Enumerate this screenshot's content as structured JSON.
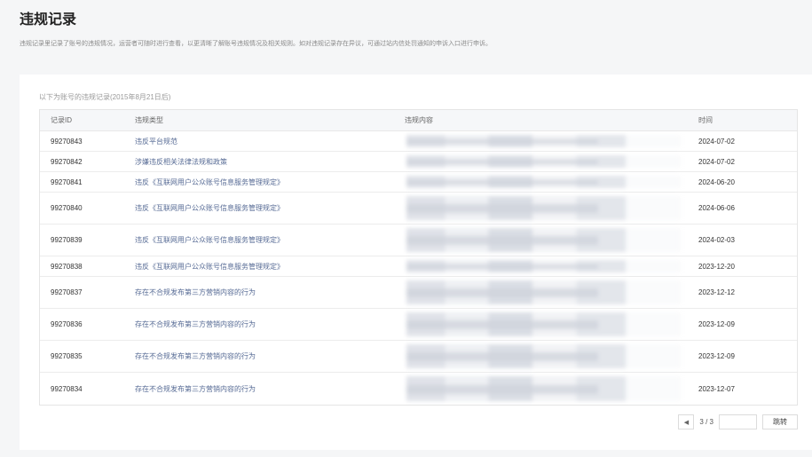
{
  "page": {
    "title": "违规记录",
    "description": "违规记录里记录了账号的违规情况，运营者可随时进行查看，以更清晰了解账号违规情况及相关规则。如对违规记录存在异议，可通过站内信处罚通知的申诉入口进行申诉。"
  },
  "table": {
    "caption": "以下为账号的违规记录(2015年8月21日后)",
    "columns": {
      "id": "记录ID",
      "type": "违规类型",
      "content": "违规内容",
      "time": "时间"
    },
    "rows": [
      {
        "id": "99270843",
        "type": "违反平台规范",
        "time": "2024-07-02"
      },
      {
        "id": "99270842",
        "type": "涉嫌违反相关法律法规和政策",
        "time": "2024-07-02"
      },
      {
        "id": "99270841",
        "type": "违反《互联网用户公众账号信息服务管理规定》",
        "time": "2024-06-20"
      },
      {
        "id": "99270840",
        "type": "违反《互联网用户公众账号信息服务管理规定》",
        "time": "2024-06-06"
      },
      {
        "id": "99270839",
        "type": "违反《互联网用户公众账号信息服务管理规定》",
        "time": "2024-02-03"
      },
      {
        "id": "99270838",
        "type": "违反《互联网用户公众账号信息服务管理规定》",
        "time": "2023-12-20"
      },
      {
        "id": "99270837",
        "type": "存在不合规发布第三方营销内容的行为",
        "time": "2023-12-12"
      },
      {
        "id": "99270836",
        "type": "存在不合规发布第三方营销内容的行为",
        "time": "2023-12-09"
      },
      {
        "id": "99270835",
        "type": "存在不合规发布第三方营销内容的行为",
        "time": "2023-12-09"
      },
      {
        "id": "99270834",
        "type": "存在不合规发布第三方营销内容的行为",
        "time": "2023-12-07"
      }
    ]
  },
  "pagination": {
    "prev_icon": "chevron-left-icon",
    "page_indicator": "3 / 3",
    "jump_input_value": "",
    "jump_label": "跳转"
  }
}
